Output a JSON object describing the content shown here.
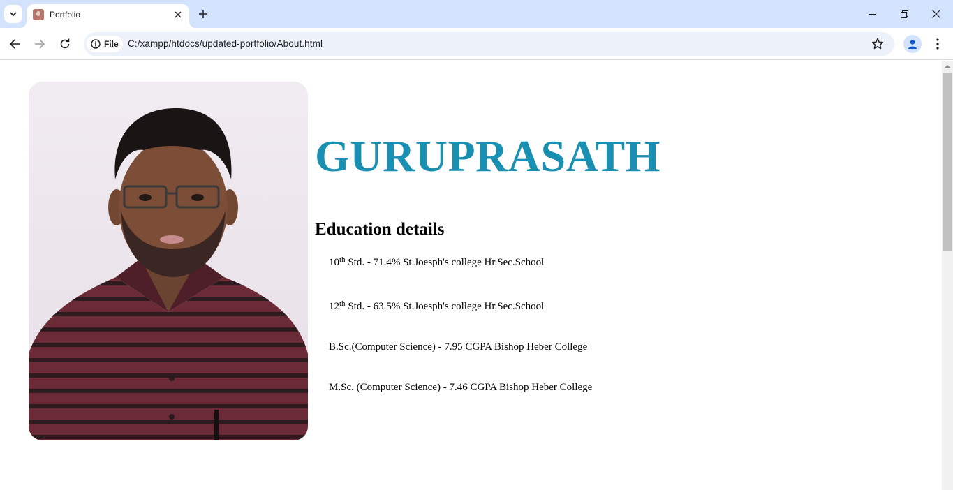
{
  "browser": {
    "tab": {
      "title": "Portfolio"
    },
    "address": {
      "scheme_label": "File",
      "url": "C:/xampp/htdocs/updated-portfolio/About.html"
    }
  },
  "page": {
    "name": "GURUPRASATH",
    "education_heading": "Education details",
    "education": [
      {
        "num": "10",
        "sup": "th",
        "text": " Std. - 71.4% St.Joesph's college Hr.Sec.School"
      },
      {
        "num": "12",
        "sup": "th",
        "text": " Std. - 63.5% St.Joesph's college Hr.Sec.School"
      },
      {
        "num": "",
        "sup": "",
        "text": "B.Sc.(Computer Science) - 7.95 CGPA Bishop Heber College"
      },
      {
        "num": "",
        "sup": "",
        "text": "M.Sc. (Computer Science) - 7.46 CGPA Bishop Heber College"
      }
    ]
  },
  "colors": {
    "name_accent": "#1990b2",
    "tabstrip": "#d3e3fd",
    "omnibox": "#edf2fa"
  },
  "icons": [
    "tab-search-icon",
    "close-icon",
    "plus-icon",
    "minimize-icon",
    "restore-icon",
    "back-arrow-icon",
    "forward-arrow-icon",
    "reload-icon",
    "info-icon",
    "star-icon",
    "profile-icon",
    "kebab-menu-icon",
    "scroll-up-arrow-icon"
  ]
}
